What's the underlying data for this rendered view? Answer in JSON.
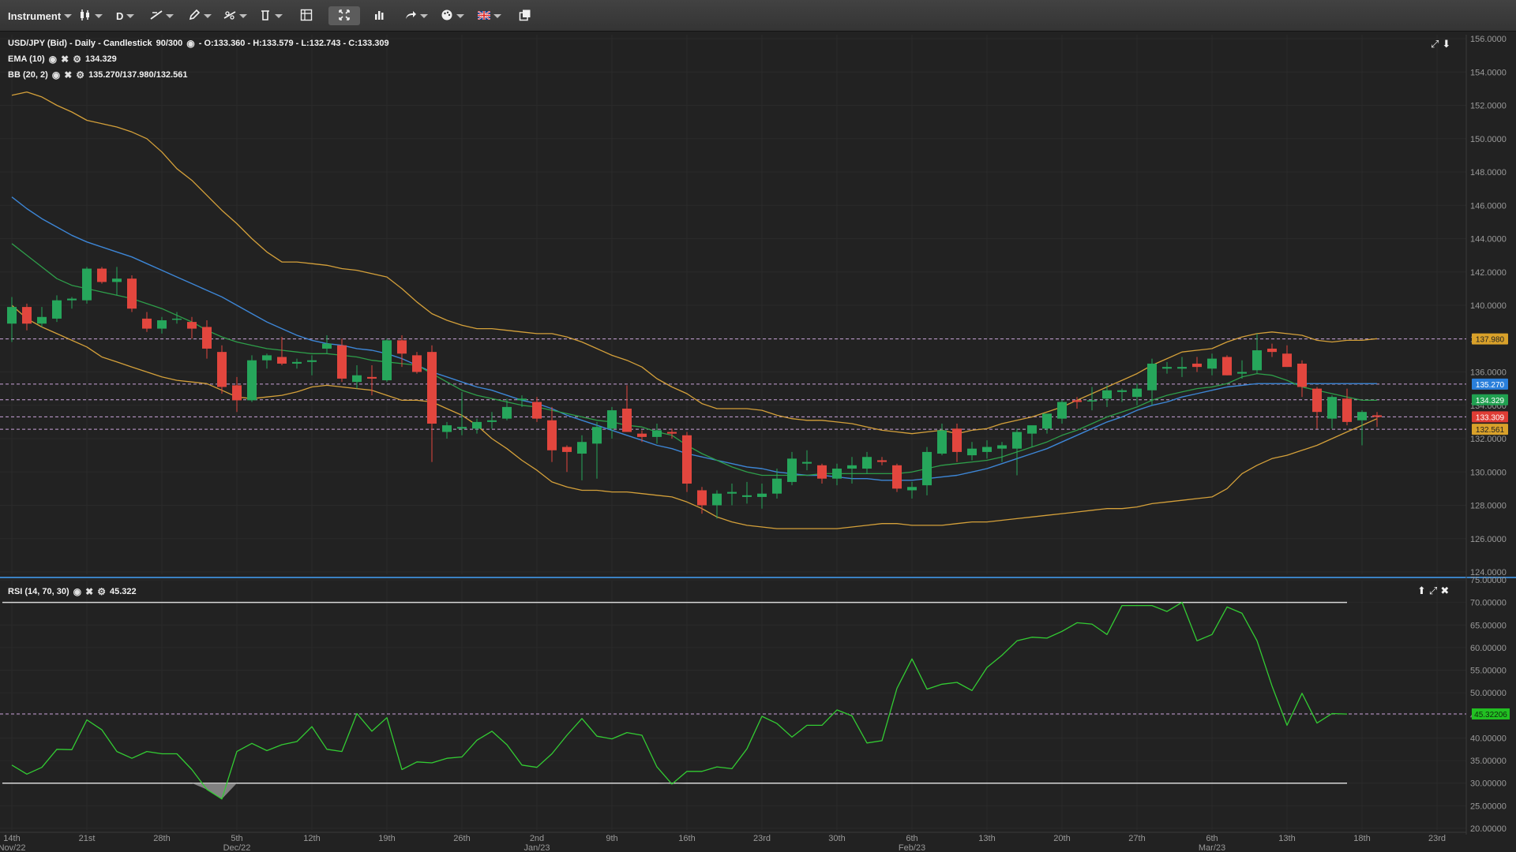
{
  "toolbar": {
    "instrument_label": "Instrument",
    "period_label": "D"
  },
  "legend": {
    "main": {
      "title": "USD/JPY (Bid) - Daily - Candlestick",
      "bars": "90/300",
      "ohlc": "- O:133.360 - H:133.579 - L:132.743 - C:133.309"
    },
    "ema": {
      "label": "EMA (10)",
      "value": "134.329"
    },
    "bb": {
      "label": "BB (20, 2)",
      "value": "135.270/137.980/132.561"
    },
    "rsi": {
      "label": "RSI (14, 70, 30)",
      "value": "45.322"
    }
  },
  "colors": {
    "background": "#1f1f1f",
    "up": "#26a65b",
    "down": "#e2463e",
    "bollinger": "#d4a03a",
    "bollinger_mid": "#3d86d6",
    "ema": "#2e9e4a",
    "rsi_line": "#33cc33",
    "grid": "#2a2a2a"
  },
  "chart_data": [
    {
      "type": "candlestick",
      "title": "USD/JPY (Bid) - Daily - Candlestick",
      "ylim": [
        124,
        156
      ],
      "yticks": [
        "156.0000",
        "154.0000",
        "152.0000",
        "150.0000",
        "148.0000",
        "146.0000",
        "144.0000",
        "142.0000",
        "140.0000",
        "138.0000",
        "136.0000",
        "134.0000",
        "132.0000",
        "130.0000",
        "128.0000",
        "126.0000",
        "124.0000"
      ],
      "ytick_values": [
        156,
        154,
        152,
        150,
        148,
        146,
        144,
        142,
        140,
        138,
        136,
        134,
        132,
        130,
        128,
        126,
        124
      ],
      "xticks": [
        {
          "label": "14th",
          "sub": "Nov/22",
          "i": 0
        },
        {
          "label": "21st",
          "sub": "",
          "i": 5
        },
        {
          "label": "28th",
          "sub": "",
          "i": 10
        },
        {
          "label": "5th",
          "sub": "Dec/22",
          "i": 15
        },
        {
          "label": "12th",
          "sub": "",
          "i": 20
        },
        {
          "label": "19th",
          "sub": "",
          "i": 25
        },
        {
          "label": "26th",
          "sub": "",
          "i": 30
        },
        {
          "label": "2nd",
          "sub": "Jan/23",
          "i": 35
        },
        {
          "label": "9th",
          "sub": "",
          "i": 40
        },
        {
          "label": "16th",
          "sub": "",
          "i": 45
        },
        {
          "label": "23rd",
          "sub": "",
          "i": 50
        },
        {
          "label": "30th",
          "sub": "",
          "i": 55
        },
        {
          "label": "6th",
          "sub": "Feb/23",
          "i": 60
        },
        {
          "label": "13th",
          "sub": "",
          "i": 65
        },
        {
          "label": "20th",
          "sub": "",
          "i": 70
        },
        {
          "label": "27th",
          "sub": "",
          "i": 75
        },
        {
          "label": "6th",
          "sub": "Mar/23",
          "i": 80
        },
        {
          "label": "13th",
          "sub": "",
          "i": 85
        },
        {
          "label": "18th",
          "sub": "",
          "i": 90
        },
        {
          "label": "23rd",
          "sub": "",
          "i": 95
        }
      ],
      "candles": [
        [
          138.9,
          140.5,
          137.8,
          139.9
        ],
        [
          139.9,
          140.1,
          138.5,
          138.9
        ],
        [
          138.9,
          139.9,
          138.7,
          139.3
        ],
        [
          139.2,
          140.6,
          139.0,
          140.3
        ],
        [
          140.3,
          140.5,
          139.8,
          140.4
        ],
        [
          140.3,
          142.3,
          140.1,
          142.2
        ],
        [
          142.2,
          142.3,
          141.3,
          141.4
        ],
        [
          141.4,
          142.3,
          140.6,
          141.6
        ],
        [
          141.6,
          141.8,
          139.6,
          139.8
        ],
        [
          139.2,
          139.6,
          138.4,
          138.6
        ],
        [
          138.6,
          139.3,
          138.3,
          139.1
        ],
        [
          139.2,
          139.6,
          138.9,
          139.2
        ],
        [
          139.0,
          139.3,
          138.0,
          138.6
        ],
        [
          138.7,
          139.1,
          136.8,
          137.4
        ],
        [
          137.2,
          137.6,
          134.7,
          135.1
        ],
        [
          135.2,
          135.7,
          133.6,
          134.3
        ],
        [
          134.3,
          137.0,
          134.2,
          136.7
        ],
        [
          136.7,
          137.1,
          136.2,
          137.0
        ],
        [
          136.9,
          138.1,
          136.4,
          136.5
        ],
        [
          136.5,
          136.8,
          136.2,
          136.6
        ],
        [
          136.6,
          137.0,
          135.8,
          136.7
        ],
        [
          137.4,
          138.2,
          137.1,
          137.7
        ],
        [
          137.6,
          138.0,
          135.4,
          135.6
        ],
        [
          135.4,
          136.4,
          135.0,
          135.8
        ],
        [
          135.7,
          136.4,
          134.6,
          135.6
        ],
        [
          135.5,
          138.0,
          135.4,
          137.9
        ],
        [
          137.9,
          138.2,
          136.3,
          137.1
        ],
        [
          137.0,
          137.2,
          135.9,
          136.0
        ],
        [
          137.2,
          137.6,
          130.6,
          132.9
        ],
        [
          132.4,
          133.0,
          132.0,
          132.8
        ],
        [
          132.6,
          134.8,
          132.2,
          132.7
        ],
        [
          132.6,
          133.2,
          132.3,
          133.0
        ],
        [
          133.0,
          133.6,
          132.6,
          133.1
        ],
        [
          133.2,
          134.4,
          133.1,
          133.9
        ],
        [
          134.3,
          134.6,
          133.9,
          134.4
        ],
        [
          134.2,
          134.5,
          133.0,
          133.2
        ],
        [
          133.1,
          133.9,
          130.6,
          131.3
        ],
        [
          131.5,
          131.6,
          130.0,
          131.2
        ],
        [
          131.1,
          132.2,
          129.5,
          131.8
        ],
        [
          131.7,
          133.0,
          129.6,
          132.7
        ],
        [
          132.6,
          133.9,
          132.0,
          133.7
        ],
        [
          133.8,
          135.2,
          132.4,
          132.4
        ],
        [
          132.3,
          132.5,
          131.8,
          132.1
        ],
        [
          132.1,
          132.9,
          131.7,
          132.5
        ],
        [
          132.4,
          132.6,
          132.0,
          132.3
        ],
        [
          132.2,
          132.4,
          128.8,
          129.3
        ],
        [
          128.9,
          129.1,
          127.5,
          128.0
        ],
        [
          128.0,
          128.9,
          127.2,
          128.7
        ],
        [
          128.7,
          129.3,
          128.0,
          128.8
        ],
        [
          128.5,
          129.4,
          128.1,
          128.6
        ],
        [
          128.5,
          129.3,
          127.8,
          128.7
        ],
        [
          128.7,
          130.2,
          128.4,
          129.6
        ],
        [
          129.4,
          131.2,
          129.2,
          130.8
        ],
        [
          130.5,
          131.3,
          130.1,
          130.6
        ],
        [
          130.4,
          130.5,
          129.3,
          129.6
        ],
        [
          129.6,
          130.5,
          129.2,
          130.2
        ],
        [
          130.2,
          130.9,
          129.3,
          130.4
        ],
        [
          130.2,
          131.2,
          129.9,
          130.9
        ],
        [
          130.7,
          130.9,
          130.4,
          130.6
        ],
        [
          130.4,
          130.5,
          128.8,
          129.0
        ],
        [
          128.9,
          129.4,
          128.4,
          129.1
        ],
        [
          129.2,
          131.5,
          128.6,
          131.2
        ],
        [
          131.1,
          132.9,
          131.0,
          132.5
        ],
        [
          132.6,
          132.9,
          130.6,
          131.2
        ],
        [
          131.0,
          131.8,
          130.7,
          131.4
        ],
        [
          131.2,
          131.9,
          130.8,
          131.5
        ],
        [
          131.4,
          131.8,
          130.6,
          131.6
        ],
        [
          131.4,
          132.6,
          129.8,
          132.4
        ],
        [
          132.3,
          132.7,
          131.5,
          132.8
        ],
        [
          132.6,
          133.4,
          132.3,
          133.5
        ],
        [
          133.2,
          134.3,
          132.9,
          134.2
        ],
        [
          134.3,
          134.5,
          133.8,
          134.2
        ],
        [
          134.3,
          135.1,
          133.7,
          134.3
        ],
        [
          134.4,
          135.2,
          133.9,
          134.9
        ],
        [
          134.8,
          135.0,
          134.2,
          134.9
        ],
        [
          134.5,
          135.3,
          134.0,
          135.0
        ],
        [
          134.9,
          136.8,
          134.0,
          136.5
        ],
        [
          136.2,
          136.6,
          135.9,
          136.3
        ],
        [
          136.2,
          136.9,
          135.7,
          136.3
        ],
        [
          136.5,
          136.9,
          136.0,
          136.3
        ],
        [
          136.2,
          137.1,
          135.8,
          136.8
        ],
        [
          136.9,
          137.0,
          135.8,
          135.8
        ],
        [
          135.9,
          136.7,
          135.6,
          136.0
        ],
        [
          136.1,
          138.3,
          135.9,
          137.3
        ],
        [
          137.4,
          137.7,
          136.9,
          137.2
        ],
        [
          137.1,
          137.6,
          136.5,
          136.3
        ],
        [
          136.5,
          136.7,
          134.5,
          135.1
        ],
        [
          135.0,
          135.1,
          132.6,
          133.6
        ],
        [
          133.2,
          134.6,
          132.6,
          134.5
        ],
        [
          134.4,
          135.0,
          132.8,
          133.0
        ],
        [
          133.1,
          133.7,
          131.6,
          133.6
        ],
        [
          133.4,
          133.6,
          132.7,
          133.3
        ]
      ],
      "bollinger_upper": [
        152.6,
        152.8,
        152.5,
        152.0,
        151.6,
        151.1,
        150.9,
        150.7,
        150.4,
        150.0,
        149.2,
        148.2,
        147.5,
        146.6,
        145.7,
        144.9,
        144.0,
        143.2,
        142.6,
        142.6,
        142.5,
        142.4,
        142.2,
        142.1,
        141.9,
        141.7,
        141.0,
        140.2,
        139.5,
        139.1,
        138.8,
        138.6,
        138.6,
        138.5,
        138.4,
        138.3,
        138.3,
        138.1,
        137.8,
        137.4,
        137.0,
        136.7,
        136.3,
        135.6,
        135.1,
        134.7,
        134.1,
        133.8,
        133.8,
        133.8,
        133.7,
        133.4,
        133.2,
        133.1,
        133.1,
        133.0,
        132.9,
        132.7,
        132.5,
        132.4,
        132.3,
        132.4,
        132.5,
        132.3,
        132.5,
        132.6,
        132.9,
        133.1,
        133.3,
        133.6,
        133.9,
        134.3,
        134.7,
        135.1,
        135.5,
        135.9,
        136.4,
        136.8,
        137.2,
        137.3,
        137.4,
        137.8,
        138.1,
        138.3,
        138.4,
        138.3,
        138.2,
        137.9,
        137.8,
        137.9,
        137.9,
        138.0
      ],
      "bollinger_mid": [
        146.5,
        145.8,
        145.2,
        144.7,
        144.2,
        143.8,
        143.5,
        143.2,
        142.9,
        142.5,
        142.1,
        141.7,
        141.3,
        140.9,
        140.5,
        140.0,
        139.5,
        139.0,
        138.6,
        138.2,
        137.9,
        137.7,
        137.6,
        137.4,
        137.3,
        137.1,
        136.8,
        136.4,
        136.0,
        135.7,
        135.4,
        135.1,
        134.9,
        134.6,
        134.3,
        134.1,
        133.8,
        133.4,
        133.1,
        132.8,
        132.5,
        132.2,
        131.9,
        131.6,
        131.4,
        131.1,
        130.9,
        130.7,
        130.5,
        130.3,
        130.2,
        130.0,
        129.9,
        129.8,
        129.8,
        129.7,
        129.6,
        129.6,
        129.5,
        129.5,
        129.5,
        129.6,
        129.7,
        129.8,
        130.0,
        130.2,
        130.5,
        130.8,
        131.1,
        131.4,
        131.8,
        132.2,
        132.6,
        133.0,
        133.3,
        133.7,
        134.0,
        134.2,
        134.5,
        134.7,
        134.9,
        135.1,
        135.2,
        135.3,
        135.3,
        135.3,
        135.3,
        135.3,
        135.3,
        135.3,
        135.3,
        135.3
      ],
      "bollinger_lower": [
        140.0,
        139.2,
        138.7,
        138.3,
        137.9,
        137.5,
        136.9,
        136.6,
        136.3,
        136.0,
        135.7,
        135.5,
        135.4,
        135.3,
        134.9,
        134.5,
        134.4,
        134.5,
        134.6,
        134.8,
        135.1,
        135.2,
        135.1,
        135.0,
        134.9,
        134.6,
        134.3,
        134.3,
        134.2,
        133.8,
        133.4,
        132.8,
        132.0,
        131.4,
        130.7,
        130.1,
        129.4,
        129.1,
        128.9,
        128.9,
        128.8,
        128.8,
        128.7,
        128.6,
        128.5,
        128.2,
        127.8,
        127.3,
        127.0,
        126.8,
        126.7,
        126.6,
        126.6,
        126.6,
        126.6,
        126.6,
        126.7,
        126.8,
        126.9,
        126.9,
        126.8,
        126.8,
        126.8,
        126.9,
        127.0,
        127.0,
        127.1,
        127.2,
        127.3,
        127.4,
        127.5,
        127.6,
        127.7,
        127.8,
        127.8,
        127.9,
        128.1,
        128.2,
        128.3,
        128.4,
        128.5,
        129.0,
        129.9,
        130.4,
        130.8,
        131.0,
        131.3,
        131.6,
        132.0,
        132.4,
        132.8,
        133.2
      ],
      "ema": [
        143.7,
        143.0,
        142.3,
        141.6,
        141.2,
        141.0,
        140.8,
        140.6,
        140.4,
        140.1,
        139.8,
        139.4,
        139.0,
        138.5,
        138.1,
        137.8,
        137.6,
        137.4,
        137.3,
        137.2,
        137.1,
        137.1,
        137.0,
        136.9,
        136.7,
        136.6,
        136.5,
        136.4,
        135.9,
        135.4,
        134.9,
        134.6,
        134.4,
        134.2,
        134.0,
        133.9,
        133.7,
        133.5,
        133.3,
        133.1,
        133.0,
        132.8,
        132.7,
        132.4,
        132.2,
        131.6,
        131.1,
        130.7,
        130.3,
        130.0,
        129.8,
        129.8,
        129.8,
        129.8,
        129.9,
        129.9,
        129.9,
        129.9,
        129.9,
        129.9,
        130.0,
        130.2,
        130.4,
        130.5,
        130.6,
        130.7,
        130.9,
        131.2,
        131.5,
        131.8,
        132.2,
        132.5,
        132.9,
        133.3,
        133.6,
        133.9,
        134.3,
        134.6,
        134.8,
        135.0,
        135.1,
        135.3,
        135.7,
        135.9,
        135.8,
        135.5,
        135.1,
        134.9,
        134.7,
        134.5,
        134.3,
        134.3
      ],
      "levels": [
        137.98,
        135.27,
        134.329,
        133.309,
        132.561
      ],
      "level_labels": [
        "137.980",
        "135.270",
        "134.329",
        "133.309",
        "132.561"
      ],
      "level_colors": [
        "#d9a12a",
        "#2a7fdb",
        "#20a050",
        "#e03d35",
        "#d9a12a"
      ]
    },
    {
      "type": "line",
      "title": "RSI (14, 70, 30)",
      "ylim": [
        20,
        75
      ],
      "yticks": [
        "75.00000",
        "70.00000",
        "65.00000",
        "60.00000",
        "55.00000",
        "50.00000",
        "45.00000",
        "40.00000",
        "35.00000",
        "30.00000",
        "25.00000",
        "20.00000"
      ],
      "ytick_values": [
        75,
        70,
        65,
        60,
        55,
        50,
        45,
        40,
        35,
        30,
        25,
        20
      ],
      "overbought": 70,
      "oversold": 30,
      "current_label": "45.32206",
      "current": 45.32206,
      "values": [
        34,
        32,
        33.5,
        37.5,
        37.4,
        44,
        41.8,
        37,
        35.5,
        37,
        36.5,
        36.5,
        33,
        28.6,
        26.5,
        37,
        38.8,
        37.2,
        38.5,
        39.2,
        42.5,
        37.5,
        37,
        45.4,
        41.5,
        44.5,
        33,
        34.7,
        34.5,
        35.5,
        35.8,
        39.5,
        41.5,
        38.5,
        34,
        33.5,
        36.5,
        40.6,
        44.3,
        40.4,
        39.8,
        41.2,
        40.6,
        33.6,
        29.8,
        32.6,
        32.6,
        33.6,
        33.2,
        37.6,
        44.8,
        43.2,
        40.2,
        42.8,
        42.8,
        46.2,
        44.9,
        38.9,
        39.4,
        51,
        57.5,
        50.8,
        51.9,
        52.3,
        50.5,
        55.6,
        58.3,
        61.5,
        62.3,
        62.1,
        63.6,
        65.5,
        65.2,
        62.9,
        69.3,
        69.3,
        69.3,
        68,
        70,
        61.5,
        62.9,
        69,
        67.6,
        61.5,
        51.5,
        42.8,
        49.9,
        43.3,
        45.4,
        45.3
      ]
    }
  ]
}
